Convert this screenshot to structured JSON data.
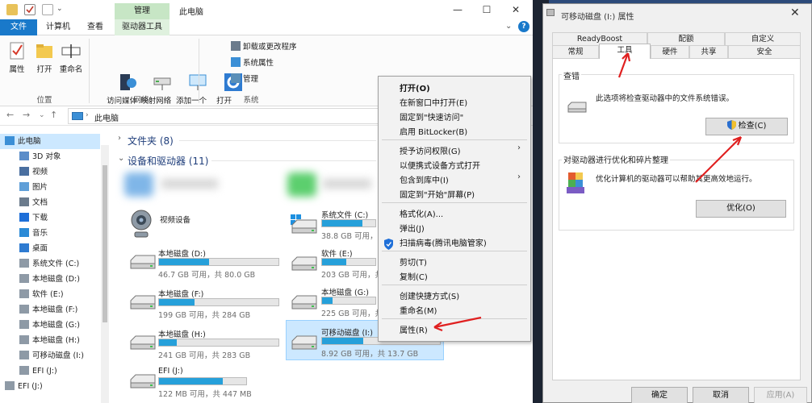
{
  "explorer": {
    "title": "此电脑",
    "manage_tab": "管理",
    "ribbon_tabs": [
      "文件",
      "计算机",
      "查看",
      "驱动器工具"
    ],
    "ribbon": {
      "location": {
        "items": [
          "属性",
          "打开",
          "重命名"
        ],
        "label": "位置"
      },
      "network": {
        "items": [
          "访问媒体",
          "映射网络\n驱动器",
          "添加一个\n网络位置"
        ],
        "label": "网络"
      },
      "system": {
        "open_settings": "打开\n设置",
        "small_items": [
          "卸载或更改程序",
          "系统属性",
          "管理"
        ],
        "label": "系统"
      }
    },
    "address": "此电脑",
    "sidebar": [
      "此电脑",
      "3D 对象",
      "视频",
      "图片",
      "文档",
      "下载",
      "音乐",
      "桌面",
      "系统文件 (C:)",
      "本地磁盘 (D:)",
      "软件 (E:)",
      "本地磁盘 (F:)",
      "本地磁盘 (G:)",
      "本地磁盘 (H:)",
      "可移动磁盘 (I:)",
      "EFI (J:)",
      "EFI (J:)"
    ],
    "folders_header": "文件夹 (8)",
    "devices_header": "设备和驱动器 (11)",
    "device_video": "视频设备",
    "drives": [
      {
        "name": "本地磁盘 (D:)",
        "size": "46.7 GB 可用，共 80.0 GB",
        "used": 0.42
      },
      {
        "name": "本地磁盘 (F:)",
        "size": "199 GB 可用，共 284 GB",
        "used": 0.3
      },
      {
        "name": "本地磁盘 (H:)",
        "size": "241 GB 可用，共 283 GB",
        "used": 0.15
      },
      {
        "name": "EFI (J:)",
        "size": "122 MB 可用，共 447 MB",
        "used": 0.73
      },
      {
        "name": "系统文件 (C:)",
        "size": "38.8 GB 可用，共",
        "used": 0.75
      },
      {
        "name": "软件 (E:)",
        "size": "203 GB 可用，共",
        "used": 0.45
      },
      {
        "name": "本地磁盘 (G:)",
        "size": "225 GB 可用，共",
        "used": 0.2
      },
      {
        "name": "可移动磁盘 (I:)",
        "size": "8.92 GB 可用，共 13.7 GB",
        "used": 0.35
      }
    ]
  },
  "context_menu": {
    "items": [
      "打开(O)",
      "在新窗口中打开(E)",
      "固定到\"快速访问\"",
      "启用 BitLocker(B)",
      "授予访问权限(G)",
      "以便携式设备方式打开",
      "包含到库中(I)",
      "固定到\"开始\"屏幕(P)",
      "格式化(A)...",
      "弹出(J)",
      "扫描病毒(腾讯电脑管家)",
      "剪切(T)",
      "复制(C)",
      "创建快捷方式(S)",
      "重命名(M)",
      "属性(R)"
    ]
  },
  "dialog": {
    "title": "可移动磁盘 (I:) 属性",
    "tabs_row1": [
      "ReadyBoost",
      "配额",
      "自定义"
    ],
    "tabs_row2": [
      "常规",
      "工具",
      "硬件",
      "共享",
      "安全"
    ],
    "check": {
      "title": "查错",
      "text": "此选项将检查驱动器中的文件系统错误。",
      "button": "检查(C)"
    },
    "optimize": {
      "title": "对驱动器进行优化和碎片整理",
      "text": "优化计算机的驱动器可以帮助其更高效地运行。",
      "button": "优化(O)"
    },
    "footer": [
      "确定",
      "取消",
      "应用(A)"
    ]
  },
  "colors": {
    "accent": "#1979ca",
    "bar_fill": "#26a0da",
    "annotation": "#e02020"
  }
}
